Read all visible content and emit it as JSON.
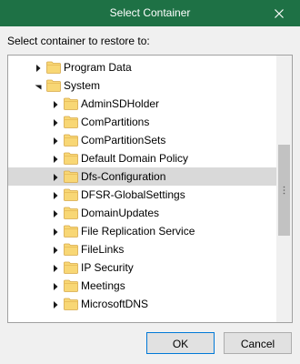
{
  "window": {
    "title": "Select Container",
    "close_icon": "close-icon",
    "accent_color": "#1e7145"
  },
  "prompt": "Select container to restore to:",
  "tree": {
    "items": [
      {
        "label": "Program Data",
        "level": 1,
        "expanded": false,
        "selected": false
      },
      {
        "label": "System",
        "level": 1,
        "expanded": true,
        "selected": false
      },
      {
        "label": "AdminSDHolder",
        "level": 2,
        "expanded": false,
        "selected": false
      },
      {
        "label": "ComPartitions",
        "level": 2,
        "expanded": false,
        "selected": false
      },
      {
        "label": "ComPartitionSets",
        "level": 2,
        "expanded": false,
        "selected": false
      },
      {
        "label": "Default Domain Policy",
        "level": 2,
        "expanded": false,
        "selected": false
      },
      {
        "label": "Dfs-Configuration",
        "level": 2,
        "expanded": false,
        "selected": true
      },
      {
        "label": "DFSR-GlobalSettings",
        "level": 2,
        "expanded": false,
        "selected": false
      },
      {
        "label": "DomainUpdates",
        "level": 2,
        "expanded": false,
        "selected": false
      },
      {
        "label": "File Replication Service",
        "level": 2,
        "expanded": false,
        "selected": false
      },
      {
        "label": "FileLinks",
        "level": 2,
        "expanded": false,
        "selected": false
      },
      {
        "label": "IP Security",
        "level": 2,
        "expanded": false,
        "selected": false
      },
      {
        "label": "Meetings",
        "level": 2,
        "expanded": false,
        "selected": false
      },
      {
        "label": "MicrosoftDNS",
        "level": 2,
        "expanded": false,
        "selected": false
      }
    ]
  },
  "buttons": {
    "ok": "OK",
    "cancel": "Cancel"
  }
}
